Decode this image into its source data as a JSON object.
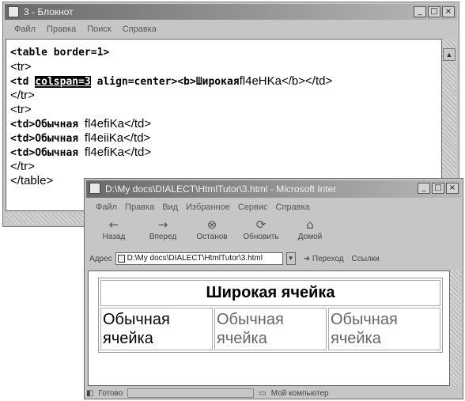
{
  "notepad": {
    "title": "3 - Блокнот",
    "menu": [
      "Файл",
      "Правка",
      "Поиск",
      "Справка"
    ],
    "code": {
      "l1": "<table border=1>",
      "l2": "<tr>",
      "l3_a": "<td ",
      "l3_sel": "colspan=3",
      "l3_b": " align=center><b>",
      "l3_c": "Широкая",
      "l3_d": "fl4eHKa</b></td>",
      "l4": "</tr>",
      "l5": "<tr>",
      "l6_a": "<td>Обычная ",
      "l6_b": "fl4efiKa</td>",
      "l7_a": "<td>Обычная ",
      "l7_b": "fl4eiiKa</td>",
      "l8_a": "<td>Обычная ",
      "l8_b": "fl4efiKa</td>",
      "l9": "</tr>",
      "l10": "</table>"
    }
  },
  "browser": {
    "title": "D:\\My docs\\DIALECT\\HtmlTutor\\3.html - Microsoft Inter",
    "menu": [
      "Файл",
      "Правка",
      "Вид",
      "Избранное",
      "Сервис",
      "Справка"
    ],
    "toolbar": {
      "back": "Назад",
      "forward": "Вперед",
      "stop": "Останов",
      "refresh": "Обновить",
      "home": "Домой"
    },
    "address": {
      "label": "Адрес",
      "value": "D:\\My docs\\DIALECT\\HtmlTutor\\3.html",
      "go": "Переход",
      "links": "Ссылки"
    },
    "page": {
      "wide_cell": "Широкая ячейка",
      "cells": [
        "Обычная ячейка",
        "Обычная ячейка",
        "Обычная ячейка"
      ]
    },
    "status": {
      "text": "Готово",
      "zone": "Мой компьютер"
    }
  }
}
